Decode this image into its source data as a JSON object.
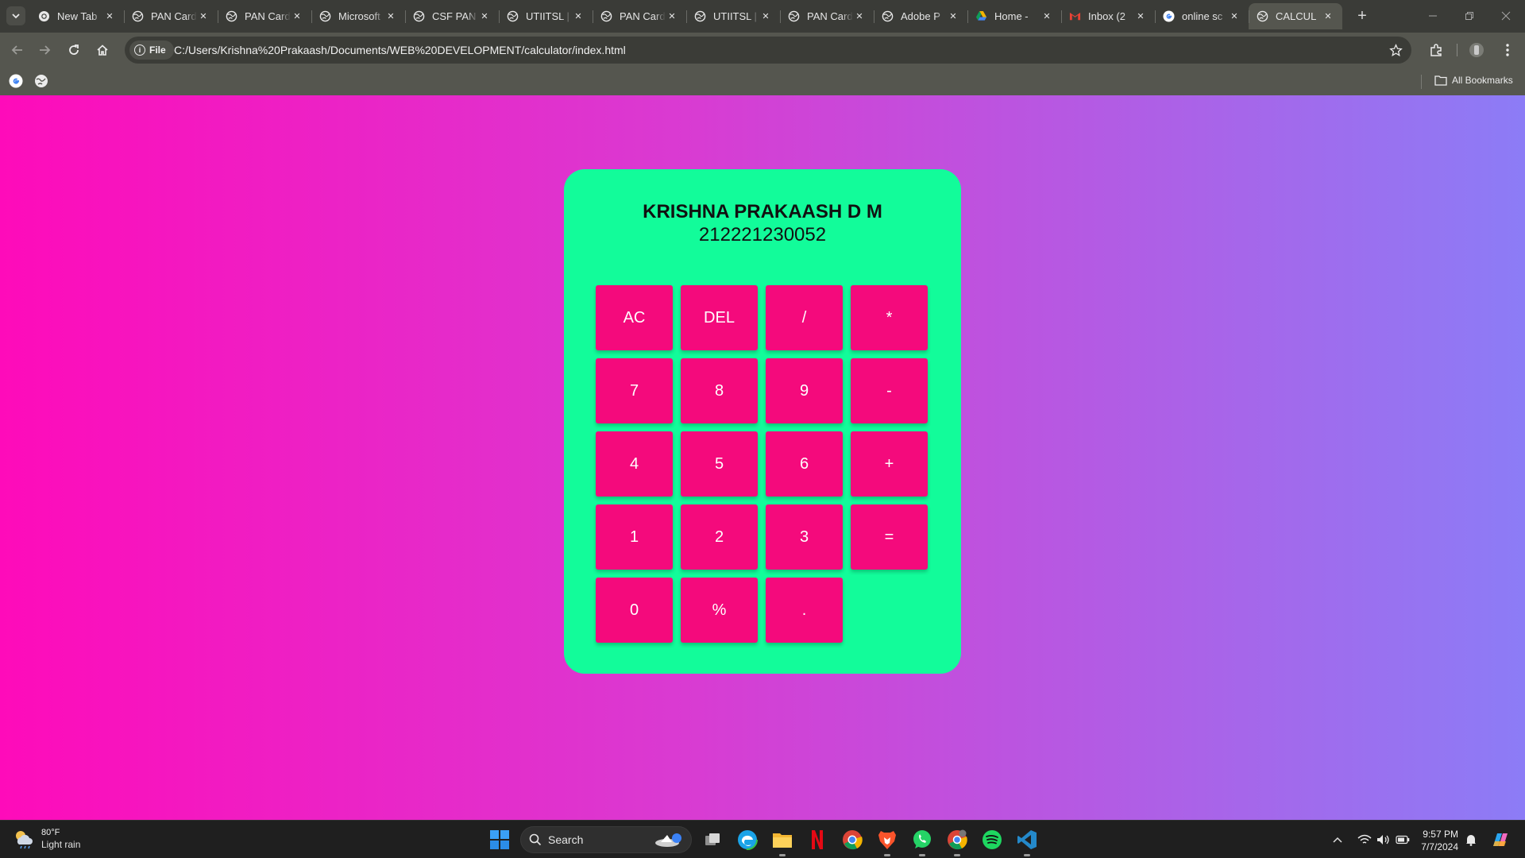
{
  "browser": {
    "tabs": [
      {
        "title": "New Tab",
        "icon": "chrome-icon",
        "active": false
      },
      {
        "title": "PAN Card",
        "icon": "globe-icon",
        "active": false
      },
      {
        "title": "PAN Card",
        "icon": "globe-icon",
        "active": false
      },
      {
        "title": "Microsoft",
        "icon": "globe-icon",
        "active": false
      },
      {
        "title": "CSF PAN",
        "icon": "globe-icon",
        "active": false
      },
      {
        "title": "UTIITSL |",
        "icon": "globe-icon",
        "active": false
      },
      {
        "title": "PAN Card",
        "icon": "globe-icon",
        "active": false
      },
      {
        "title": "UTIITSL |",
        "icon": "globe-icon",
        "active": false
      },
      {
        "title": "PAN Card",
        "icon": "globe-icon",
        "active": false
      },
      {
        "title": "Adobe P",
        "icon": "globe-icon",
        "active": false
      },
      {
        "title": "Home - ",
        "icon": "google-drive-icon",
        "active": false
      },
      {
        "title": "Inbox (2",
        "icon": "gmail-icon",
        "active": false
      },
      {
        "title": "online sc",
        "icon": "google-icon",
        "active": false
      },
      {
        "title": "CALCUL",
        "icon": "globe-icon",
        "active": true
      }
    ],
    "address": {
      "chip_label": "File",
      "url": "C:/Users/Krishna%20Prakaash/Documents/WEB%20DEVELOPMENT/calculator/index.html"
    },
    "bookmarks": {
      "items": [
        "google-icon",
        "globe-icon"
      ],
      "all_bookmarks_label": "All Bookmarks"
    }
  },
  "page": {
    "background_colors": [
      "#fe0bba",
      "#8c7cf6"
    ],
    "calculator": {
      "panel_color": "#12fc9a",
      "key_color": "#f40a7c",
      "owner_name": "KRISHNA PRAKAASH D M",
      "owner_id": "212221230052",
      "keys": [
        {
          "label": "AC",
          "row": 0,
          "col": 0
        },
        {
          "label": "DEL",
          "row": 0,
          "col": 1
        },
        {
          "label": "/",
          "row": 0,
          "col": 2
        },
        {
          "label": "*",
          "row": 0,
          "col": 3
        },
        {
          "label": "7",
          "row": 1,
          "col": 0
        },
        {
          "label": "8",
          "row": 1,
          "col": 1
        },
        {
          "label": "9",
          "row": 1,
          "col": 2
        },
        {
          "label": "-",
          "row": 1,
          "col": 3
        },
        {
          "label": "4",
          "row": 2,
          "col": 0
        },
        {
          "label": "5",
          "row": 2,
          "col": 1
        },
        {
          "label": "6",
          "row": 2,
          "col": 2
        },
        {
          "label": "+",
          "row": 2,
          "col": 3
        },
        {
          "label": "1",
          "row": 3,
          "col": 0
        },
        {
          "label": "2",
          "row": 3,
          "col": 1
        },
        {
          "label": "3",
          "row": 3,
          "col": 2
        },
        {
          "label": "=",
          "row": 3,
          "col": 3
        },
        {
          "label": "0",
          "row": 4,
          "col": 0
        },
        {
          "label": "%",
          "row": 4,
          "col": 1
        },
        {
          "label": ".",
          "row": 4,
          "col": 2
        }
      ]
    }
  },
  "taskbar": {
    "weather": {
      "temp": "80°F",
      "condition": "Light rain"
    },
    "search_label": "Search",
    "apps": [
      "task-view-icon",
      "edge-icon",
      "file-explorer-icon",
      "netflix-icon",
      "chrome-icon",
      "brave-icon",
      "whatsapp-icon",
      "chrome-profile-icon",
      "spotify-icon",
      "vscode-icon"
    ],
    "clock": {
      "time": "9:57 PM",
      "date": "7/7/2024"
    }
  }
}
